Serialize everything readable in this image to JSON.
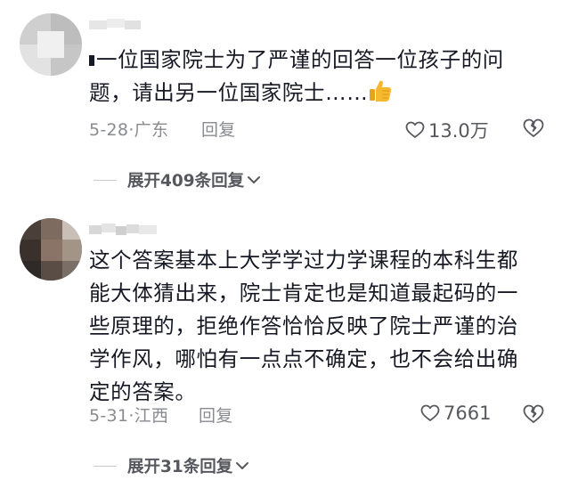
{
  "comments": [
    {
      "prefix": "▸",
      "text": "一位国家院士为了严谨的回答一位孩子的问题，请出另一位国家院士……",
      "emoji": "thumbs-up-icon",
      "date": "5-28·广东",
      "reply_label": "回复",
      "likes": "13.0万",
      "expand_label": "展开409条回复"
    },
    {
      "text": "这个答案基本上大学学过力学课程的本科生都能大体猜出来，院士肯定也是知道最起码的一些原理的，拒绝作答恰恰反映了院士严谨的治学作风，哪怕有一点点不确定，也不会给出确定的答案。",
      "date": "5-31·江西",
      "reply_label": "回复",
      "likes": "7661",
      "expand_label": "展开31条回复"
    }
  ],
  "colors": {
    "text": "#161823",
    "meta": "#8a8b91",
    "expand": "#57585e",
    "emoji": "#f5b82e"
  }
}
